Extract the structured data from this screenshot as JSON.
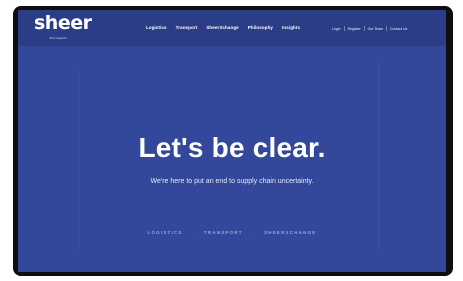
{
  "brand": {
    "logo_text": "sheer",
    "tagline": "think logistics"
  },
  "nav": {
    "main": [
      "Logistics",
      "Transport",
      "SheerXchange",
      "Philosophy",
      "Insights"
    ],
    "utility": [
      "Login",
      "Register",
      "Our Team",
      "Contact Us"
    ]
  },
  "hero": {
    "title": "Let's be clear.",
    "subtitle": "We're here to put an end to supply chain uncertainty."
  },
  "services": [
    "LOGISTICS",
    "TRANSPORT",
    "SHEERXCHANGE"
  ],
  "colors": {
    "hero_background": "#34489b",
    "navbar_background": "#2c3d87",
    "frame": "#0e0e12"
  }
}
